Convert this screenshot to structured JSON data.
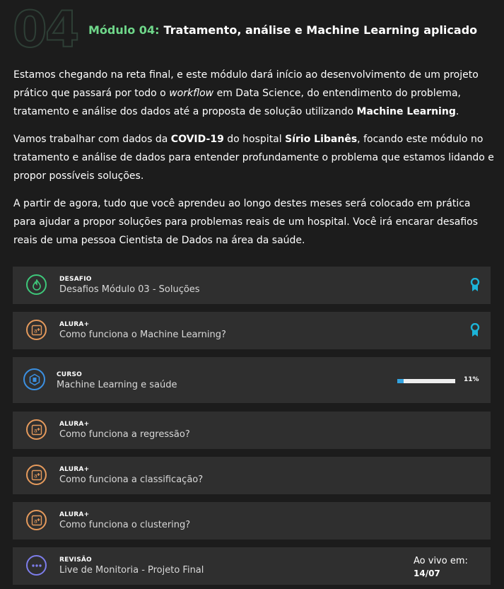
{
  "module": {
    "number": "04",
    "label": "Módulo 04:",
    "title": "Tratamento, análise e Machine Learning aplicado"
  },
  "intro": {
    "p1_a": "Estamos chegando na reta final, e este módulo dará início ao desenvolvimento de um projeto prático que passará por todo o ",
    "p1_em": "workflow",
    "p1_b": " em Data Science, do entendimento do problema, tratamento e análise dos dados até a proposta de solução utilizando ",
    "p1_strong": "Machine Learning",
    "p1_c": ".",
    "p2_a": "Vamos trabalhar com dados da ",
    "p2_strong1": "COVID-19",
    "p2_b": " do hospital ",
    "p2_strong2": "Sírio Libanês",
    "p2_c": ", focando este módulo no tratamento e análise de dados para entender profundamente o problema que estamos lidando e propor possíveis soluções.",
    "p3": "A partir de agora, tudo que você aprendeu ao longo destes meses será colocado em prática para ajudar a propor soluções para problemas reais de um hospital. Você irá encarar desafios reais de uma pessoa Cientista de Dados na área da saúde."
  },
  "items": [
    {
      "category": "DESAFIO",
      "title": "Desafios Módulo 03 - Soluções",
      "icon": "flame-icon",
      "color": "#3ec77a",
      "badge": "award-ribbon-icon"
    },
    {
      "category": "ALURA+",
      "title": "Como funciona o Machine Learning?",
      "icon": "alura-plus-icon",
      "color": "#e59a5c",
      "badge": "award-ribbon-icon"
    },
    {
      "category": "CURSO",
      "title": "Machine Learning e saúde",
      "icon": "course-hexagon-icon",
      "color": "#3b8fe0",
      "progress_percent": 11,
      "progress_label": "11%"
    },
    {
      "category": "ALURA+",
      "title": "Como funciona a regressão?",
      "icon": "alura-plus-icon",
      "color": "#e59a5c"
    },
    {
      "category": "ALURA+",
      "title": "Como funciona a classificação?",
      "icon": "alura-plus-icon",
      "color": "#e59a5c"
    },
    {
      "category": "ALURA+",
      "title": "Como funciona o clustering?",
      "icon": "alura-plus-icon",
      "color": "#e59a5c"
    },
    {
      "category": "REVISÃO",
      "title": "Live de Monitoria - Projeto Final",
      "icon": "dots-icon",
      "color": "#7d7dea",
      "live_label": "Ao vivo em:",
      "live_date": "14/07"
    }
  ],
  "colors": {
    "badge": "#1cb4d8",
    "progress": "#33a3e0",
    "accent": "#6fd78a"
  }
}
